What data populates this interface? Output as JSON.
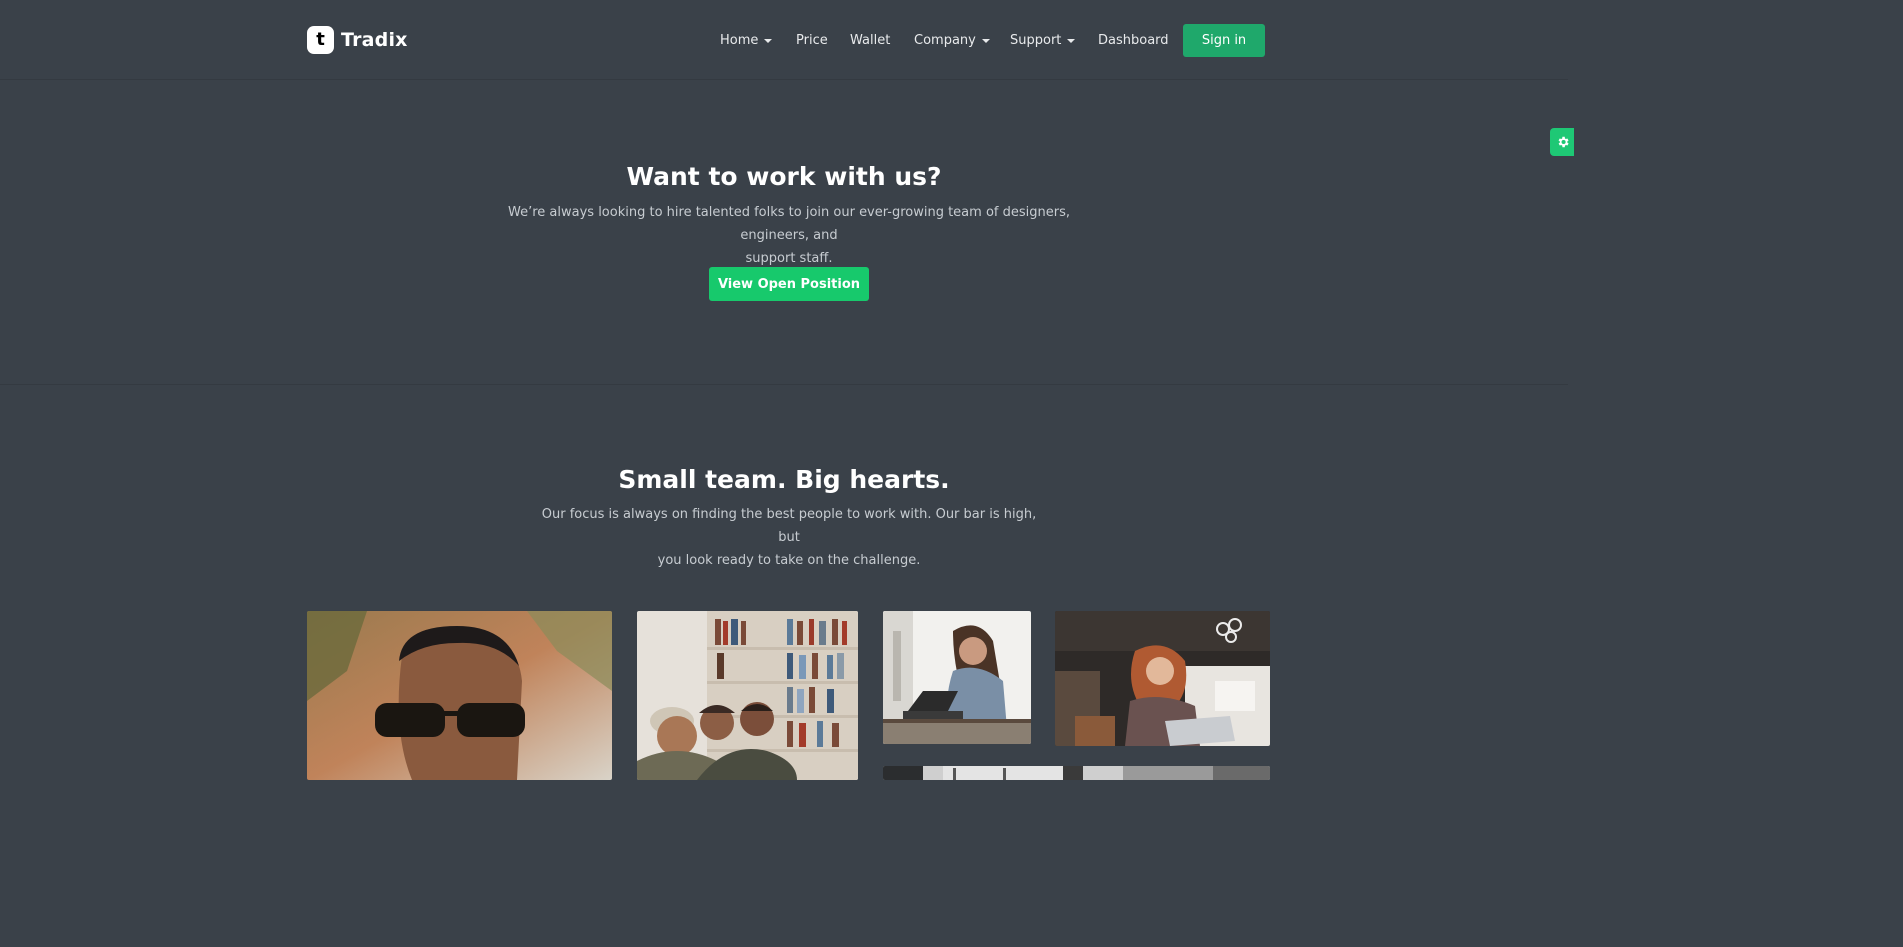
{
  "brand": {
    "name": "Tradix",
    "mark": "t"
  },
  "nav": {
    "items": [
      {
        "label": "Home",
        "dropdown": true
      },
      {
        "label": "Price",
        "dropdown": false
      },
      {
        "label": "Wallet",
        "dropdown": false
      },
      {
        "label": "Company",
        "dropdown": true
      },
      {
        "label": "Support",
        "dropdown": true
      },
      {
        "label": "Dashboard",
        "dropdown": false
      }
    ],
    "signin_label": "Sign in"
  },
  "careers": {
    "title": "Want to work with us?",
    "text_line1": "We’re always looking to hire talented folks to join our ever-growing team of designers, engineers, and",
    "text_line2": "support staff.",
    "cta_label": "View Open Position"
  },
  "team": {
    "title": "Small team. Big hearts.",
    "text_line1": "Our focus is always on finding the best people to work with. Our bar is high, but",
    "text_line2": "you look ready to take on the challenge."
  },
  "photos": [
    {
      "name": "portrait-sunglasses-photo"
    },
    {
      "name": "team-bookshelf-photo"
    },
    {
      "name": "woman-laptop-photo"
    },
    {
      "name": "woman-cafe-laptop-photo"
    },
    {
      "name": "office-window-photo"
    }
  ],
  "colors": {
    "background": "#3a4149",
    "accent": "#17c96c",
    "signin": "#1fa86b",
    "text_muted": "#c7ccd1"
  },
  "icons": {
    "settings": "gear-icon"
  }
}
